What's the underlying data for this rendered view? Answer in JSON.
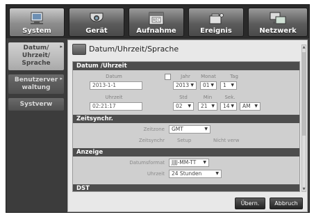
{
  "tabs": [
    {
      "label": "System",
      "icon": "system-icon",
      "active": true
    },
    {
      "label": "Gerät",
      "icon": "camera-icon",
      "active": false
    },
    {
      "label": "Aufnahme",
      "icon": "rec-icon",
      "active": false
    },
    {
      "label": "Ereignis",
      "icon": "event-icon",
      "active": false
    },
    {
      "label": "Netzwerk",
      "icon": "network-icon",
      "active": false
    }
  ],
  "sidebar": {
    "items": [
      {
        "label_1": "Datum/",
        "label_2": "Uhrzeit/",
        "label_3": "Sprache"
      },
      {
        "label_1": "Benutzerver",
        "label_2": "waltung"
      },
      {
        "label_1": "Systverw"
      }
    ]
  },
  "window": {
    "title": "Datum/Uhrzeit/Sprache"
  },
  "sections": {
    "datetime": "Datum /Uhrzeit",
    "sync": "Zeitsynchr.",
    "display": "Anzeige",
    "dst": "DST"
  },
  "datetime": {
    "date_label": "Datum",
    "date_value": "2013-1-1",
    "time_label": "Uhrzeit",
    "time_value": "02:21:17",
    "year_label": "Jahr",
    "month_label": "Monat",
    "day_label": "Tag",
    "year_value": "2013",
    "month_value": "01",
    "day_value": "1",
    "hour_label": "Std",
    "min_label": "Min",
    "sec_label": "Sek.",
    "hour_value": "02",
    "min_value": "21",
    "sec_value": "14",
    "ampm_value": "AM"
  },
  "sync": {
    "timezone_label": "Zeitzone",
    "timezone_value": "GMT",
    "sync_label": "Zeitsynchr",
    "setup_label": "Setup",
    "status": "Nicht verw"
  },
  "display": {
    "format_label": "Datumsformat",
    "format_value": "JJJJ-MM-TT",
    "clock_label": "Uhrzeit",
    "clock_value": "24 Stunden"
  },
  "buttons": {
    "apply": "Übern.",
    "cancel": "Abbruch"
  }
}
